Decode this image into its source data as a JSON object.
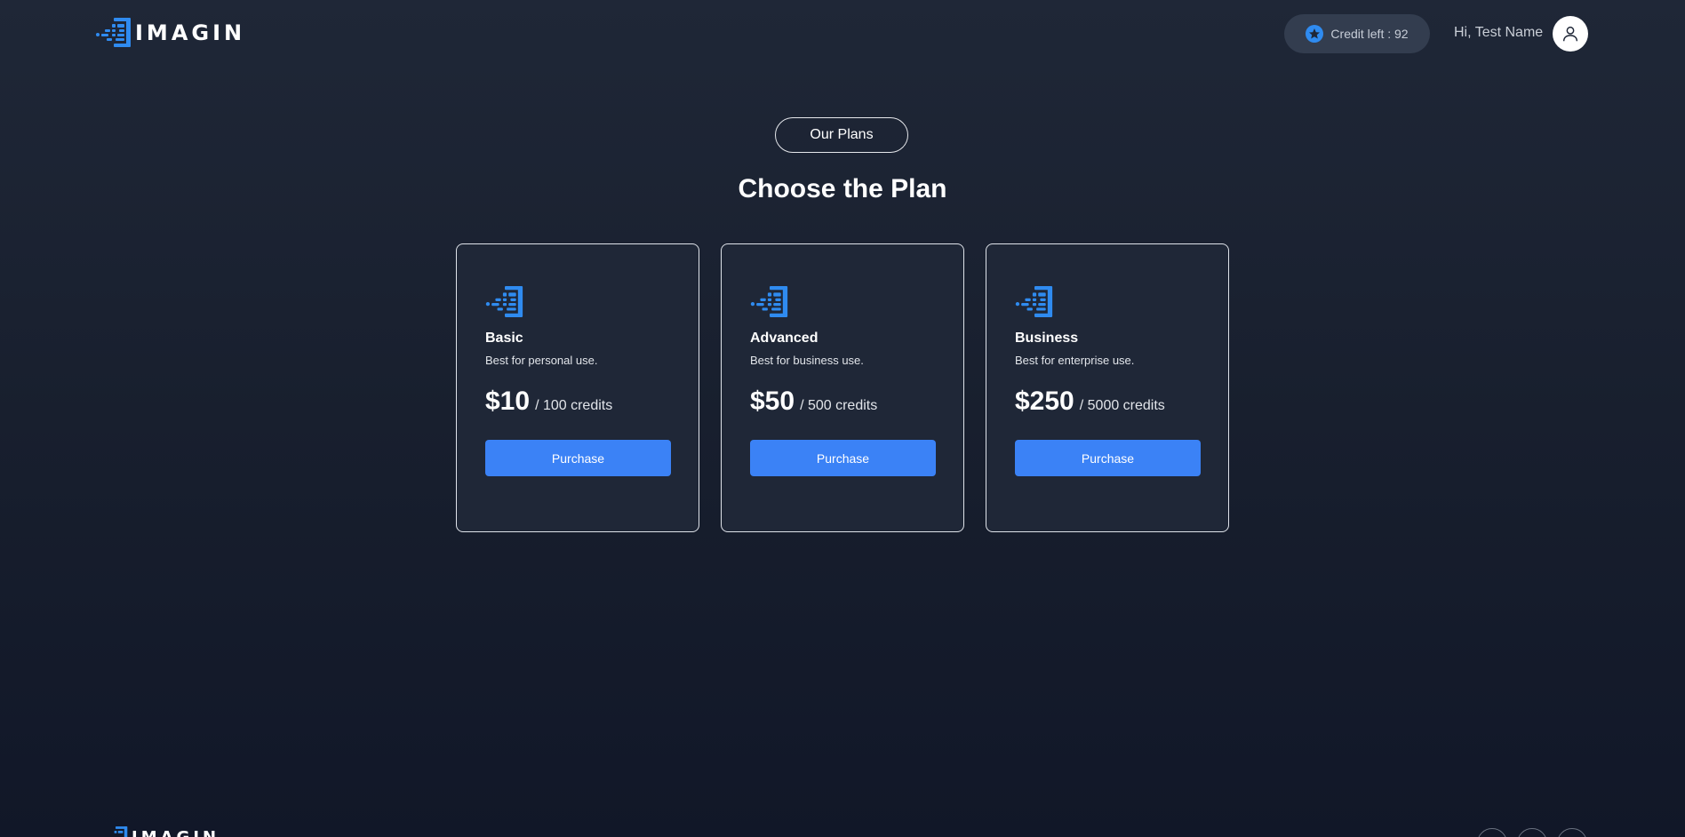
{
  "header": {
    "logo_text": "IMAGIN",
    "credit_label": "Credit left : 92",
    "greeting": "Hi, Test Name"
  },
  "section": {
    "badge": "Our Plans",
    "title": "Choose the Plan"
  },
  "plans": [
    {
      "name": "Basic",
      "description": "Best for personal use.",
      "price": "$10",
      "unit": "/ 100 credits",
      "button": "Purchase"
    },
    {
      "name": "Advanced",
      "description": "Best for business use.",
      "price": "$50",
      "unit": "/ 500 credits",
      "button": "Purchase"
    },
    {
      "name": "Business",
      "description": "Best for enterprise use.",
      "price": "$250",
      "unit": "/ 5000 credits",
      "button": "Purchase"
    }
  ],
  "footer": {
    "logo_text": "IMAGIN"
  },
  "colors": {
    "accent": "#3b82f6",
    "background": "#1f2737",
    "card_border": "#dfe3ea"
  },
  "icons": {
    "logo": "imagin-logo-icon",
    "credit": "star-badge-icon",
    "avatar": "user-icon"
  }
}
